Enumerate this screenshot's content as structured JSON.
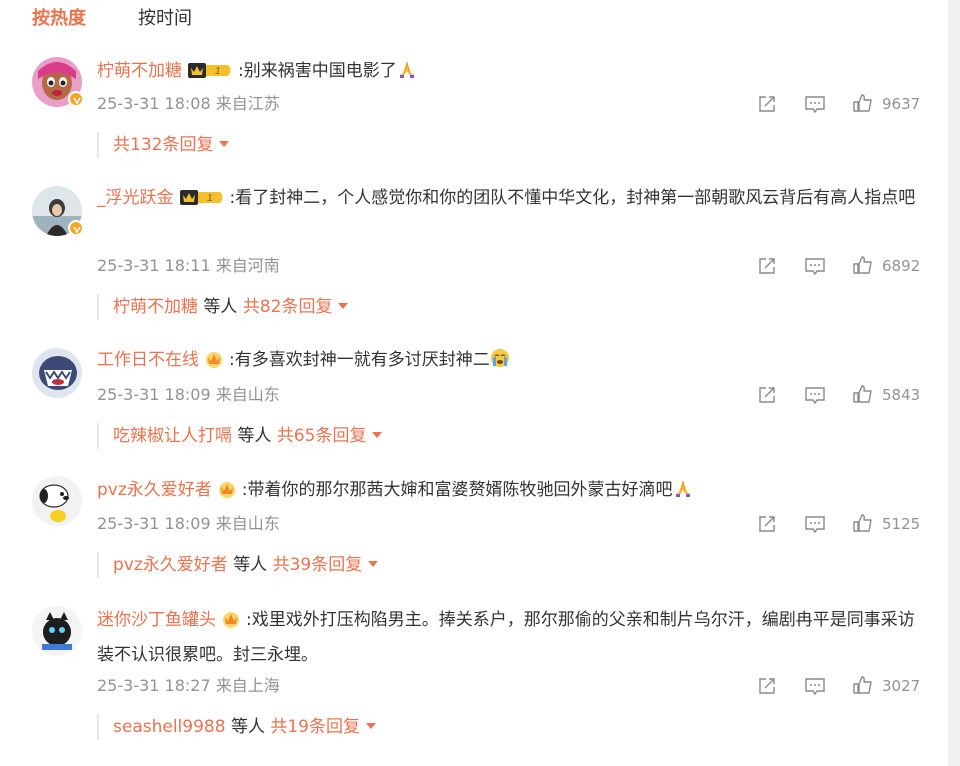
{
  "tabs": [
    {
      "label": "按热度",
      "active": true
    },
    {
      "label": "按时间",
      "active": false
    }
  ],
  "comments": [
    {
      "user": "柠萌不加糖",
      "badge": "crown-level-badge",
      "badge_level": "1",
      "prefix": ":",
      "text": "别来祸害中国电影了",
      "emoji": "pray-emoji",
      "time": "25-3-31 18:08",
      "location": "来自江苏",
      "likes": "9637",
      "reply_user": "",
      "reply_sep": "",
      "reply_count": "共132条回复"
    },
    {
      "user": "_浮光跃金",
      "badge": "crown-level-badge",
      "badge_level": "1",
      "prefix": ":",
      "text": "看了封神二，个人感觉你和你的团队不懂中华文化，封神第一部朝歌风云背后有高人指点吧",
      "emoji": "",
      "time": "25-3-31 18:11",
      "location": "来自河南",
      "likes": "6892",
      "reply_user": "柠萌不加糖",
      "reply_sep": "等人",
      "reply_count": "共82条回复"
    },
    {
      "user": "工作日不在线",
      "badge": "crown-badge",
      "badge_level": "",
      "prefix": ":",
      "text": "有多喜欢封神一就有多讨厌封神二",
      "emoji": "cry-emoji",
      "time": "25-3-31 18:09",
      "location": "来自山东",
      "likes": "5843",
      "reply_user": "吃辣椒让人打嗝",
      "reply_sep": "等人",
      "reply_count": "共65条回复"
    },
    {
      "user": "pvz永久爱好者",
      "badge": "crown-badge",
      "badge_level": "",
      "prefix": ":",
      "text": "带着你的那尔那茜大婶和富婆赘婿陈牧驰回外蒙古好滴吧",
      "emoji": "pray-emoji",
      "time": "25-3-31 18:09",
      "location": "来自山东",
      "likes": "5125",
      "reply_user": "pvz永久爱好者",
      "reply_sep": "等人",
      "reply_count": "共39条回复"
    },
    {
      "user": "迷你沙丁鱼罐头",
      "badge": "crown-badge",
      "badge_level": "",
      "prefix": ":",
      "text": "戏里戏外打压构陷男主。捧关系户，那尔那偷的父亲和制片乌尔汗，编剧冉平是同事采访装不认识很累吧。封三永埋。",
      "emoji": "",
      "time": "25-3-31 18:27",
      "location": "来自上海",
      "likes": "3027",
      "reply_user": "seashell9988",
      "reply_sep": "等人",
      "reply_count": "共19条回复"
    }
  ],
  "colors": {
    "accent": "#eb7350",
    "meta": "#939393",
    "text": "#333333",
    "verified": "#f5a623"
  },
  "icons": {
    "share": "share-icon",
    "comment": "comment-icon",
    "like": "thumbs-up-icon",
    "dropdown": "caret-down-icon"
  }
}
